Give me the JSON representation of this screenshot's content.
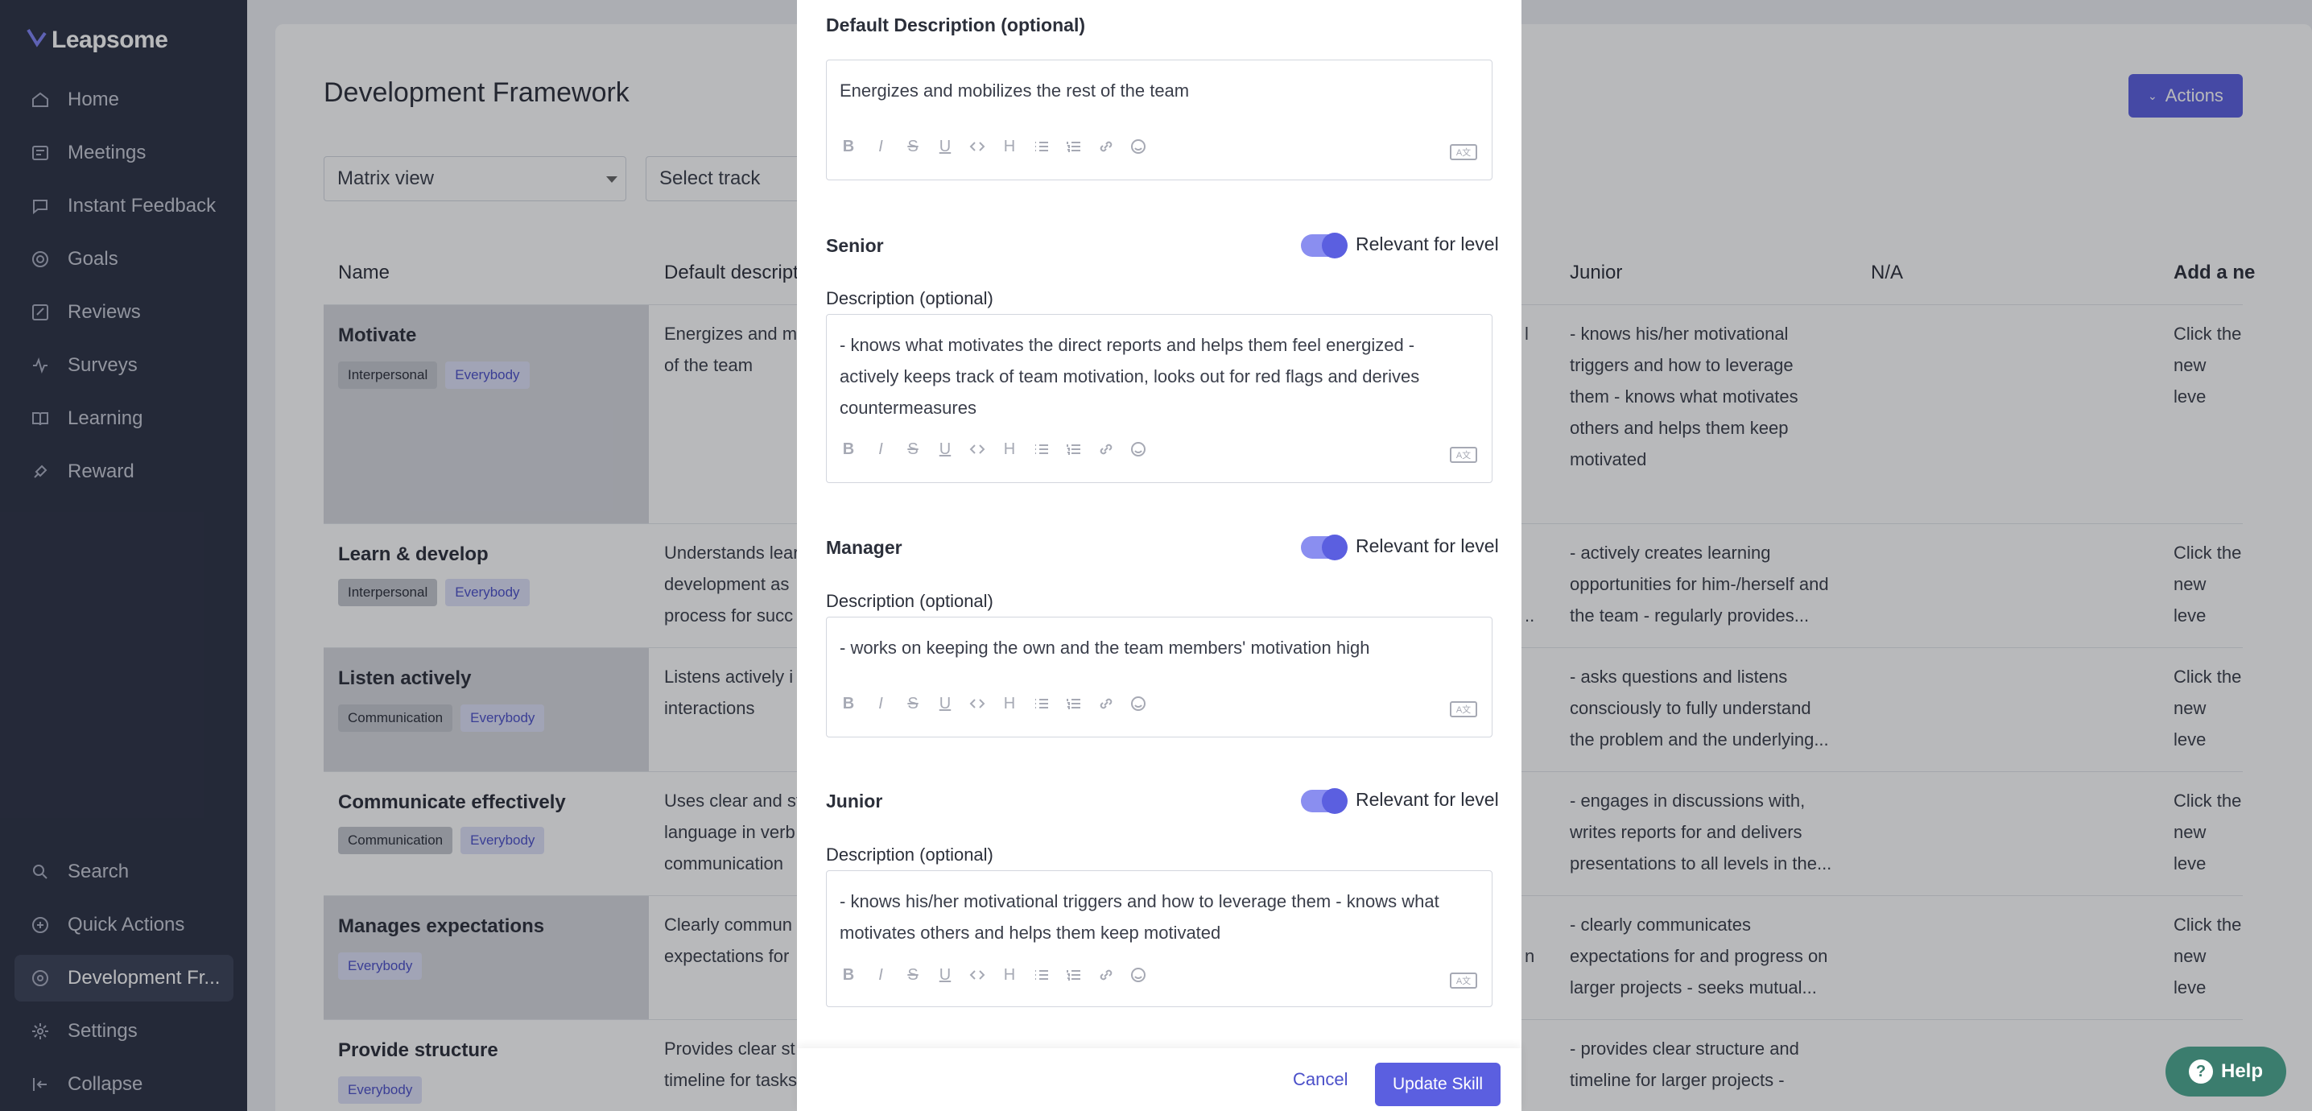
{
  "app": {
    "brand": "Leapsome"
  },
  "sidebar": {
    "items": [
      {
        "label": "Home",
        "icon": "home-icon"
      },
      {
        "label": "Meetings",
        "icon": "meetings-icon"
      },
      {
        "label": "Instant Feedback",
        "icon": "feedback-icon"
      },
      {
        "label": "Goals",
        "icon": "goals-icon"
      },
      {
        "label": "Reviews",
        "icon": "reviews-icon"
      },
      {
        "label": "Surveys",
        "icon": "surveys-icon"
      },
      {
        "label": "Learning",
        "icon": "learning-icon"
      },
      {
        "label": "Reward",
        "icon": "reward-icon"
      }
    ],
    "bottom": [
      {
        "label": "Search",
        "icon": "search-icon"
      },
      {
        "label": "Quick Actions",
        "icon": "plus-circle-icon"
      },
      {
        "label": "Development Fr...",
        "icon": "development-icon"
      },
      {
        "label": "Settings",
        "icon": "gear-icon"
      },
      {
        "label": "Collapse",
        "icon": "collapse-icon"
      }
    ]
  },
  "page": {
    "title": "Development Framework",
    "actions_label": "Actions",
    "view_select": "Matrix view",
    "track_select": "Select track"
  },
  "table": {
    "headers": {
      "name": "Name",
      "default_desc": "Default descripti",
      "junior": "Junior",
      "na": "N/A",
      "add_level": "Add a ne"
    },
    "rows": [
      {
        "name": "Motivate",
        "tags": [
          "Interpersonal",
          "Everybody"
        ],
        "desc": "Energizes and m\nof the team",
        "mid_frag": "l",
        "junior": "- knows his/her motivational\ntriggers and how to leverage\nthem - knows what motivates\nothers and helps them keep\nmotivated",
        "add": "Click the\nnew leve"
      },
      {
        "name": "Learn & develop",
        "tags": [
          "Interpersonal",
          "Everybody"
        ],
        "desc": "Understands lear\ndevelopment as\nprocess for succ",
        "mid_frag": "..",
        "junior": "- actively creates learning\nopportunities for him-/herself and\nthe team - regularly provides...",
        "add": "Click the\nnew leve"
      },
      {
        "name": "Listen actively",
        "tags": [
          "Communication",
          "Everybody"
        ],
        "desc": "Listens actively i\ninteractions",
        "mid_frag": "",
        "junior": "- asks questions and listens\nconsciously to fully understand\nthe problem and the underlying...",
        "add": "Click the\nnew leve"
      },
      {
        "name": "Communicate effectively",
        "tags": [
          "Communication",
          "Everybody"
        ],
        "desc": "Uses clear and st\nlanguage in verb\ncommunication",
        "mid_frag": "",
        "junior": "- engages in discussions with,\nwrites reports for and delivers\npresentations to all levels in the...",
        "add": "Click the\nnew leve"
      },
      {
        "name": "Manages expectations",
        "tags": [
          "Everybody"
        ],
        "desc": "Clearly commun\nexpectations for",
        "mid_frag": "n",
        "junior": "- clearly communicates\nexpectations for and progress on\nlarger projects - seeks mutual...",
        "add": "Click the\nnew leve"
      },
      {
        "name": "Provide structure",
        "tags": [
          "Everybody"
        ],
        "desc": "Provides clear st\ntimeline for tasks",
        "mid_frag": "",
        "junior": "- provides clear structure and\ntimeline for larger projects -",
        "add": ""
      }
    ]
  },
  "modal": {
    "default_label": "Default Description (optional)",
    "default_text": "Energizes and mobilizes the rest of the team",
    "relevant_label": "Relevant for level",
    "desc_label": "Description (optional)",
    "levels": [
      {
        "name": "Senior",
        "text": "- knows what motivates the direct reports and helps them feel energized - actively keeps track of team motivation, looks out for red flags and derives countermeasures"
      },
      {
        "name": "Manager",
        "text": "- works on keeping the own and the team members' motivation high"
      },
      {
        "name": "Junior",
        "text": "- knows his/her motivational triggers and how to leverage them - knows what motivates others and helps them keep motivated"
      }
    ],
    "cancel_label": "Cancel",
    "update_label": "Update Skill"
  },
  "help": {
    "label": "Help"
  },
  "colors": {
    "accent": "#5b5fe0",
    "sidebar": "#2c3144",
    "help": "#3b7d6e"
  }
}
